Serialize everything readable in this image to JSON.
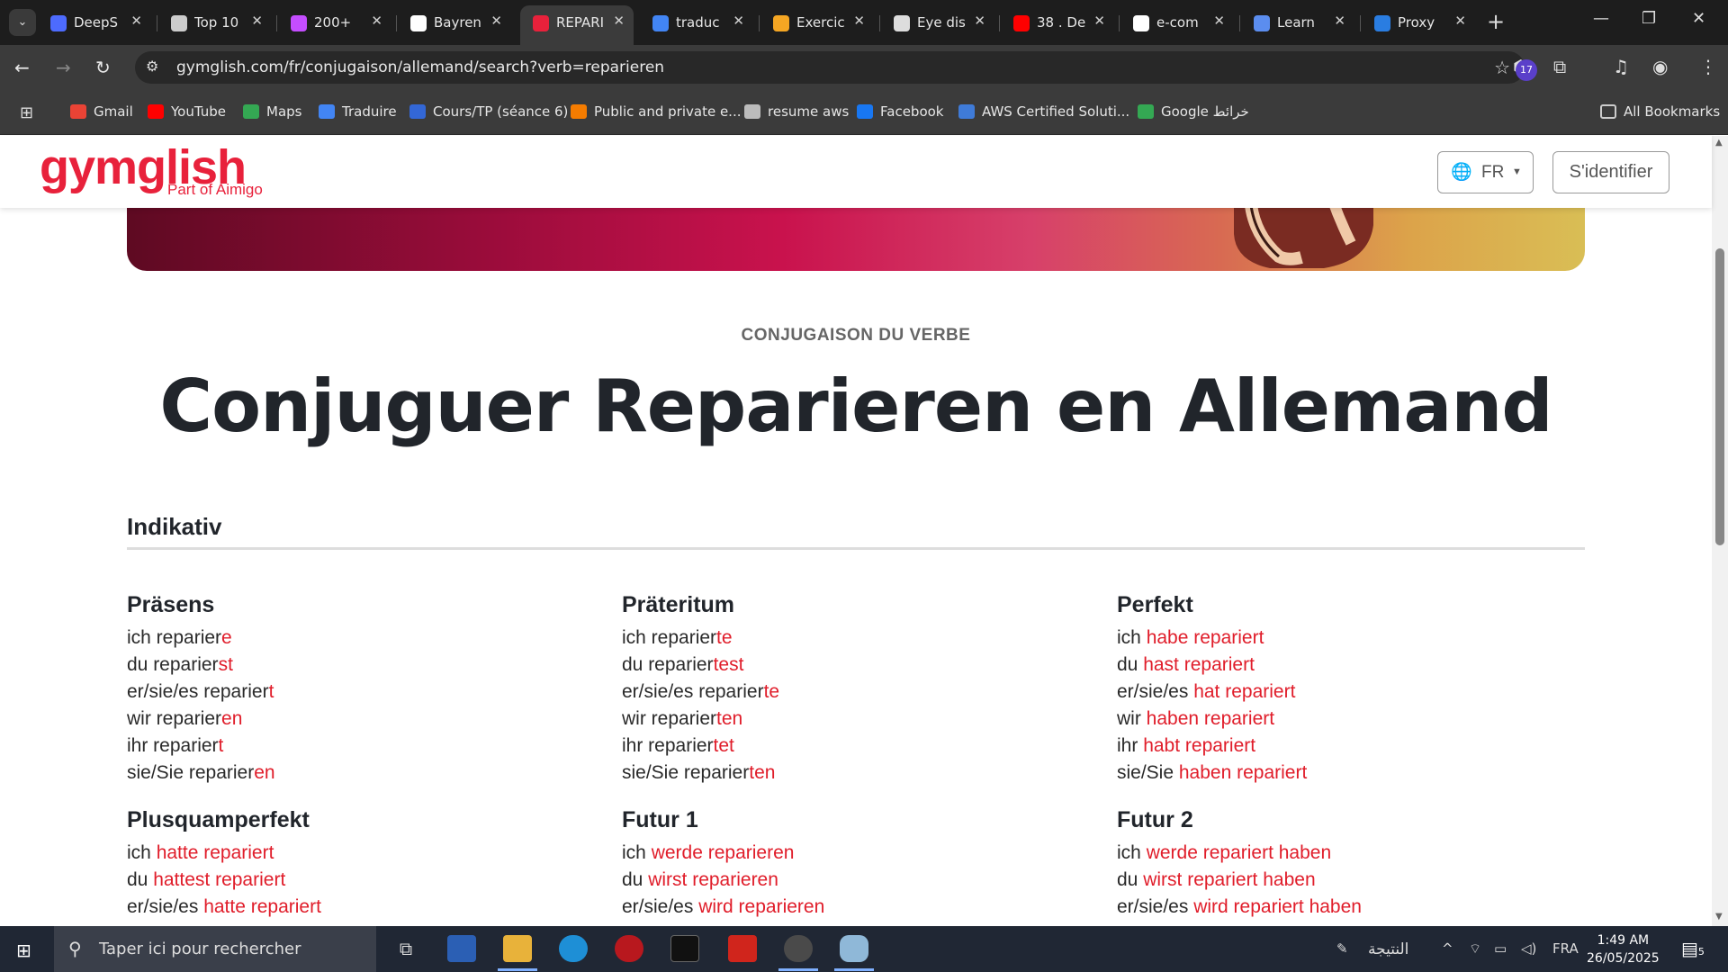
{
  "browser": {
    "tabs": [
      {
        "title": "DeepS",
        "favicon_color": "#4d6bfe"
      },
      {
        "title": "Top 10",
        "favicon_color": "#cccccc"
      },
      {
        "title": "200+",
        "favicon_color": "#c44dff"
      },
      {
        "title": "Bayren",
        "favicon_color": "#ffffff"
      },
      {
        "title": "REPARI",
        "favicon_color": "#e8213b",
        "active": true
      },
      {
        "title": "traduc",
        "favicon_color": "#4285f4"
      },
      {
        "title": "Exercic",
        "favicon_color": "#f5a623"
      },
      {
        "title": "Eye dis",
        "favicon_color": "#dddddd"
      },
      {
        "title": "38 . De",
        "favicon_color": "#ff0000"
      },
      {
        "title": "e-com",
        "favicon_color": "#ffffff"
      },
      {
        "title": "Learn",
        "favicon_color": "#5b8def"
      },
      {
        "title": "Proxy",
        "favicon_color": "#2a7de1"
      }
    ],
    "url": "gymglish.com/fr/conjugaison/allemand/search?verb=reparieren",
    "extension_badge": "17",
    "bookmarks": [
      {
        "label": "Gmail",
        "icon": "gmail-icon",
        "color": "#ea4335"
      },
      {
        "label": "YouTube",
        "icon": "youtube-icon",
        "color": "#ff0000"
      },
      {
        "label": "Maps",
        "icon": "maps-icon",
        "color": "#34a853"
      },
      {
        "label": "Traduire",
        "icon": "translate-icon",
        "color": "#4285f4"
      },
      {
        "label": "Cours/TP (séance 6)",
        "icon": "classroom-icon",
        "color": "#3367d6"
      },
      {
        "label": "Public and private e...",
        "icon": "page-icon",
        "color": "#f57c00"
      },
      {
        "label": "resume aws",
        "icon": "globe-icon",
        "color": "#bbbbbb"
      },
      {
        "label": "Facebook",
        "icon": "facebook-icon",
        "color": "#1877f2"
      },
      {
        "label": "AWS Certified Soluti...",
        "icon": "aws-icon",
        "color": "#3f7bd8"
      },
      {
        "label": "Google خرائط",
        "icon": "maps-icon",
        "color": "#34a853"
      }
    ],
    "all_bookmarks": "All Bookmarks"
  },
  "site": {
    "logo": "gymglish",
    "logo_sub": "Part of Aimigo",
    "lang": "FR",
    "login": "S'identifier",
    "brand_color": "#e8213b"
  },
  "page": {
    "kicker": "CONJUGAISON DU VERBE",
    "title": "Conjuguer Reparieren en Allemand",
    "mood": "Indikativ"
  },
  "tenses": [
    {
      "name": "Präsens",
      "rows": [
        {
          "subject": "ich reparier",
          "ending": "e"
        },
        {
          "subject": "du reparier",
          "ending": "st"
        },
        {
          "subject": "er/sie/es reparier",
          "ending": "t"
        },
        {
          "subject": "wir reparier",
          "ending": "en"
        },
        {
          "subject": "ihr reparier",
          "ending": "t"
        },
        {
          "subject": "sie/Sie reparier",
          "ending": "en"
        }
      ]
    },
    {
      "name": "Präteritum",
      "rows": [
        {
          "subject": "ich reparier",
          "ending": "te"
        },
        {
          "subject": "du reparier",
          "ending": "test"
        },
        {
          "subject": "er/sie/es reparier",
          "ending": "te"
        },
        {
          "subject": "wir reparier",
          "ending": "ten"
        },
        {
          "subject": "ihr reparier",
          "ending": "tet"
        },
        {
          "subject": "sie/Sie reparier",
          "ending": "ten"
        }
      ]
    },
    {
      "name": "Perfekt",
      "rows": [
        {
          "subject": "ich ",
          "ending": "habe repariert"
        },
        {
          "subject": "du ",
          "ending": "hast repariert"
        },
        {
          "subject": "er/sie/es ",
          "ending": "hat repariert"
        },
        {
          "subject": "wir ",
          "ending": "haben repariert"
        },
        {
          "subject": "ihr ",
          "ending": "habt repariert"
        },
        {
          "subject": "sie/Sie ",
          "ending": "haben repariert"
        }
      ]
    },
    {
      "name": "Plusquamperfekt",
      "rows": [
        {
          "subject": "ich ",
          "ending": "hatte repariert"
        },
        {
          "subject": "du ",
          "ending": "hattest repariert"
        },
        {
          "subject": "er/sie/es ",
          "ending": "hatte repariert"
        }
      ]
    },
    {
      "name": "Futur 1",
      "rows": [
        {
          "subject": "ich ",
          "ending": "werde reparieren"
        },
        {
          "subject": "du ",
          "ending": "wirst reparieren"
        },
        {
          "subject": "er/sie/es ",
          "ending": "wird reparieren"
        }
      ]
    },
    {
      "name": "Futur 2",
      "rows": [
        {
          "subject": "ich ",
          "ending": "werde repariert haben"
        },
        {
          "subject": "du ",
          "ending": "wirst repariert haben"
        },
        {
          "subject": "er/sie/es ",
          "ending": "wird repariert haben"
        }
      ]
    }
  ],
  "taskbar": {
    "search_placeholder": "Taper ici pour rechercher",
    "tray_text": "النتيجة",
    "lang": "FRA",
    "time": "1:49 AM",
    "date": "26/05/2025",
    "notifications": "5"
  }
}
